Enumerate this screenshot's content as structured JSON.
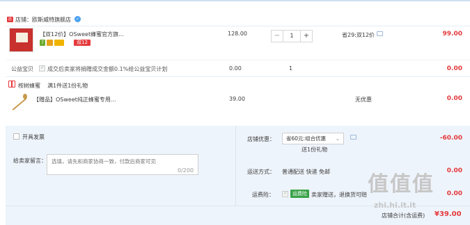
{
  "shop": {
    "icon_text": "店铺",
    "label": "店铺：欧斯威特旗舰店"
  },
  "item": {
    "title": "【双12价】OSweet蜂蜜官方旗...",
    "badges": [
      "7",
      "",
      "",
      "双12"
    ],
    "unit_price": "128.00",
    "quantity": "1",
    "minus": "−",
    "plus": "+",
    "promo": "省29:双12价",
    "total": "99.00"
  },
  "charity": {
    "label": "公益宝贝",
    "text": "成交后卖家将捐赠成交金额0.1%给公益宝贝计划",
    "price": "0.00",
    "qty": "1",
    "total": "0.00"
  },
  "gift_section": {
    "label": "桉树蜂蜜",
    "desc": "满1件送1份礼物"
  },
  "gift_item": {
    "title": "【赠品】OSweet纯正蜂蜜专用...",
    "price": "39.00",
    "promo": "无优惠",
    "total": "0.00"
  },
  "invoice": {
    "label": "开具发票"
  },
  "message": {
    "label": "给卖家留言：",
    "placeholder": "选填，请先和商家协商一致，付款后商家可见",
    "count": "0/200"
  },
  "discount": {
    "label": "店铺优惠：",
    "select": "省60元:组合优惠",
    "note": "送1份礼物",
    "amount": "-60.00"
  },
  "shipping": {
    "label": "运送方式：",
    "value": "普通配送 快递 免邮",
    "amount": "0.00"
  },
  "insurance": {
    "label": "运费险：",
    "tag": "运费险",
    "text": "卖家赠送，退换货可赔",
    "amount": "0.00"
  },
  "footer": {
    "total_label": "店铺合计(含运费)",
    "total": "¥39.00"
  },
  "watermark": {
    "brand": "值值值",
    "site": "zhi.hi.it.it"
  }
}
